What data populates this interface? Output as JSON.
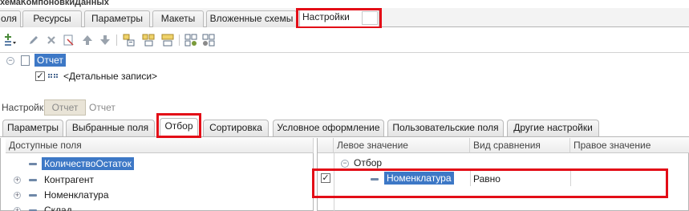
{
  "window": {
    "title": "хемаКомпоновкиДанных"
  },
  "top_tabs": [
    {
      "label": "оля"
    },
    {
      "label": "Ресурсы"
    },
    {
      "label": "Параметры"
    },
    {
      "label": "Макеты"
    },
    {
      "label": "Вложенные схемы"
    },
    {
      "label": "Настройки"
    }
  ],
  "toolbar": {
    "icons": [
      "add-dropdown-icon",
      "edit-icon",
      "delete-icon",
      "mark-icon",
      "move-up-icon",
      "move-down-icon",
      "group-icon",
      "group-add-icon",
      "group-detail-icon",
      "settings-icon",
      "settings-structure-icon"
    ]
  },
  "tree": {
    "root_label": "Отчет",
    "child_label": "<Детальные записи>",
    "child_checked": true
  },
  "settings": {
    "label": "Настройки:",
    "button_label": "Отчет",
    "text": "Отчет"
  },
  "inner_tabs": [
    {
      "label": "Параметры"
    },
    {
      "label": "Выбранные поля"
    },
    {
      "label": "Отбор"
    },
    {
      "label": "Сортировка"
    },
    {
      "label": "Условное оформление"
    },
    {
      "label": "Пользовательские поля"
    },
    {
      "label": "Другие настройки"
    }
  ],
  "available_fields": {
    "header": "Доступные поля",
    "items": [
      {
        "label": "КоличествоОстаток",
        "selected": true
      },
      {
        "label": "Контрагент"
      },
      {
        "label": "Номенклатура"
      },
      {
        "label": "Склад"
      }
    ]
  },
  "filter_table": {
    "headers": {
      "left": "Левое значение",
      "compare": "Вид сравнения",
      "right": "Правое значение"
    },
    "group_label": "Отбор",
    "rows": [
      {
        "checked": true,
        "left": "Номенклатура",
        "compare": "Равно",
        "right": ""
      }
    ]
  },
  "colors": {
    "highlight": "#e30d17",
    "selection": "#3d78c6"
  }
}
